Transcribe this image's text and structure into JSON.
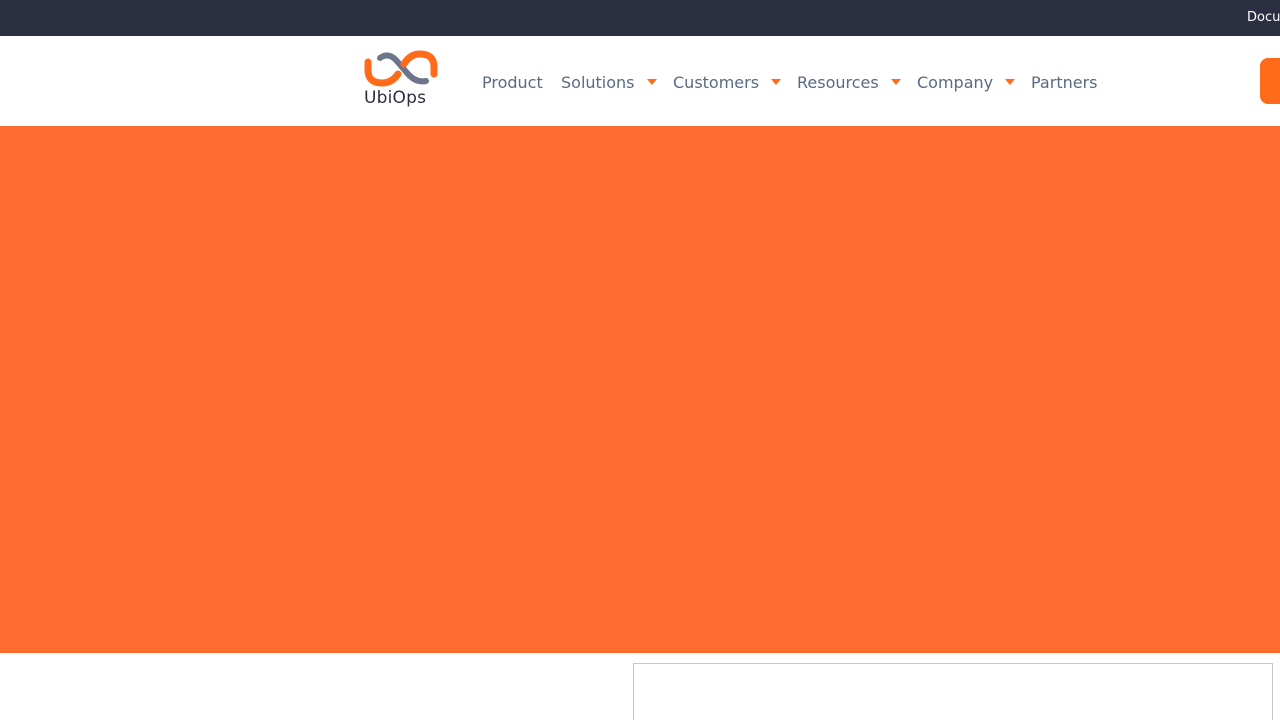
{
  "topbar": {
    "link_text": "Docum"
  },
  "brand": {
    "name": "UbiOps",
    "colors": {
      "orange": "#ff6b1a",
      "gray": "#6c7589",
      "dark": "#2c2e41"
    }
  },
  "nav": {
    "items": [
      {
        "label": "Product",
        "has_dropdown": false
      },
      {
        "label": "Solutions",
        "has_dropdown": true
      },
      {
        "label": "Customers",
        "has_dropdown": true
      },
      {
        "label": "Resources",
        "has_dropdown": true
      },
      {
        "label": "Company",
        "has_dropdown": true
      },
      {
        "label": "Partners",
        "has_dropdown": false
      }
    ]
  },
  "hero": {
    "background": "#ff6c30"
  },
  "icons": {
    "dropdown": "chevron-down-icon",
    "logo": "ubiops-logo-icon"
  }
}
